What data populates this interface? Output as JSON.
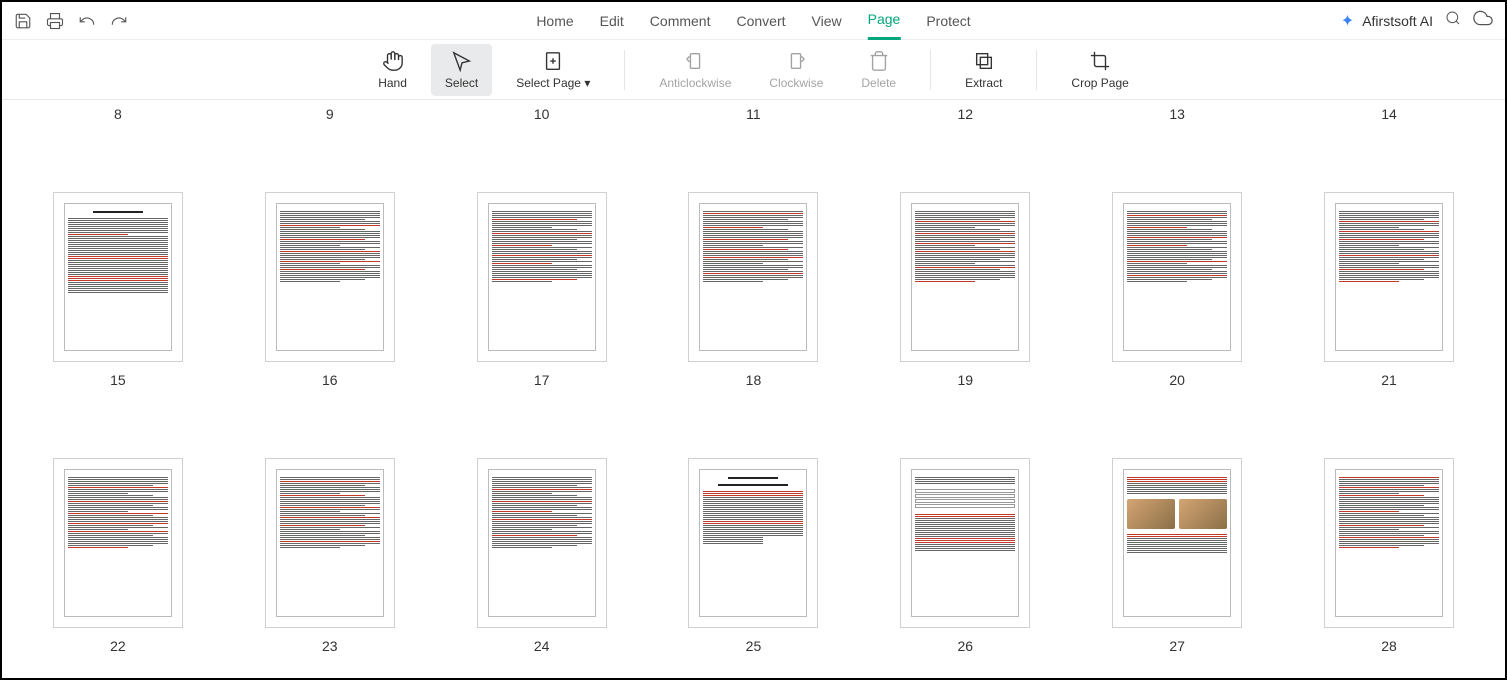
{
  "menu": {
    "home": "Home",
    "edit": "Edit",
    "comment": "Comment",
    "convert": "Convert",
    "view": "View",
    "page": "Page",
    "protect": "Protect"
  },
  "ai": {
    "label": "Afirstsoft AI"
  },
  "tools": {
    "hand": "Hand",
    "select": "Select",
    "select_page": "Select Page",
    "anticlockwise": "Anticlockwise",
    "clockwise": "Clockwise",
    "delete": "Delete",
    "extract": "Extract",
    "crop": "Crop Page"
  },
  "partial_row": [
    "8",
    "9",
    "10",
    "11",
    "12",
    "13",
    "14"
  ],
  "pages_row1": [
    "15",
    "16",
    "17",
    "18",
    "19",
    "20",
    "21"
  ],
  "pages_row2": [
    "22",
    "23",
    "24",
    "25",
    "26",
    "27",
    "28"
  ]
}
